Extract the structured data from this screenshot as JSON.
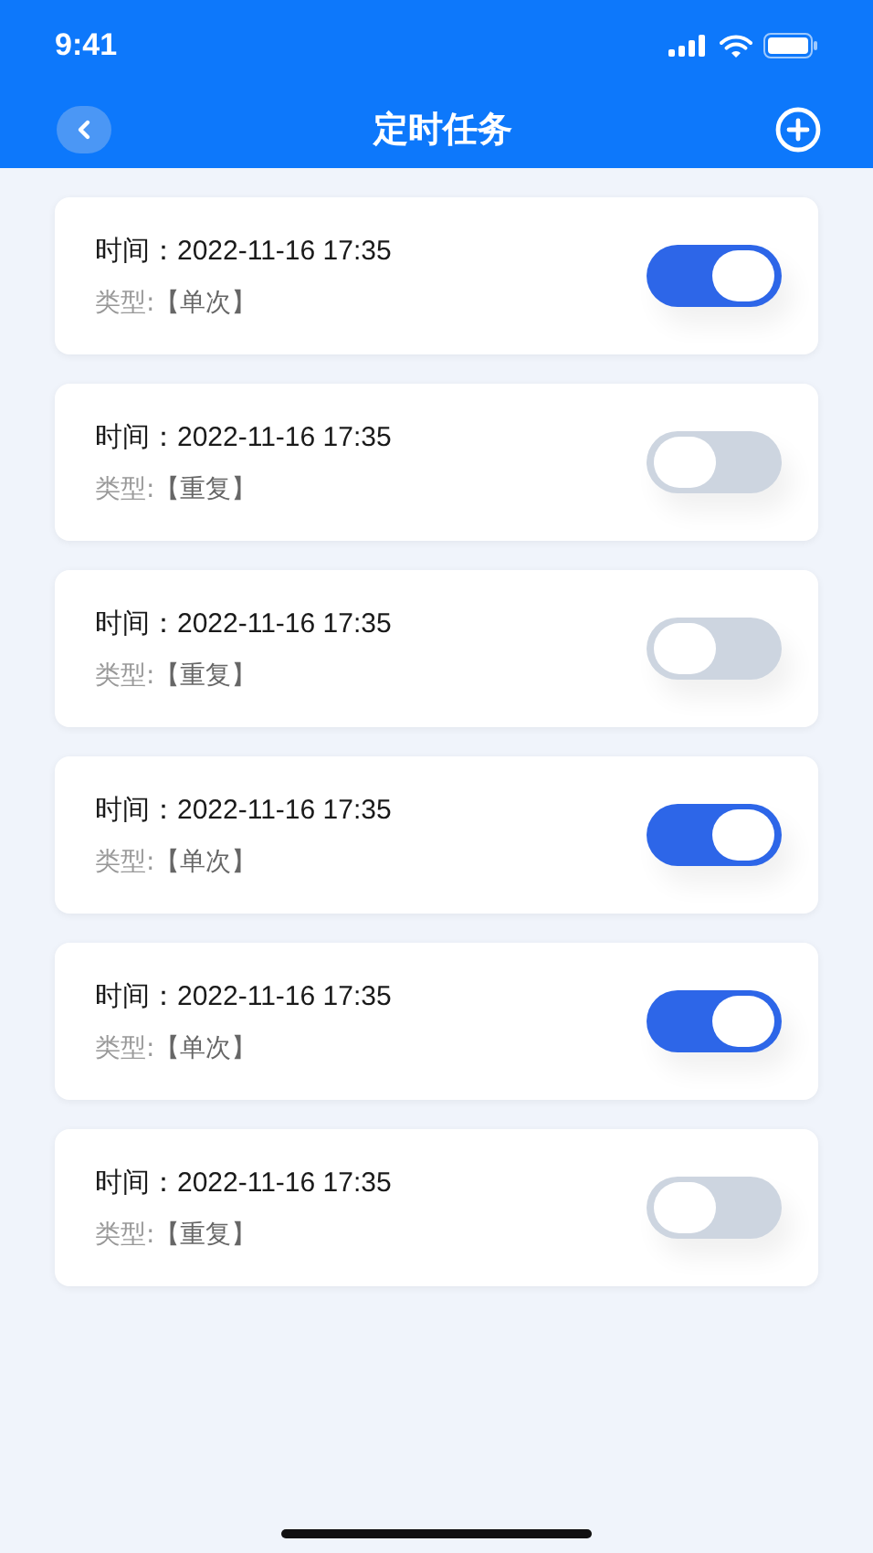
{
  "status_bar": {
    "time": "9:41"
  },
  "nav": {
    "title": "定时任务"
  },
  "tasks": [
    {
      "time": "时间：2022-11-16 17:35",
      "type_label": "类型:",
      "type": "【单次】",
      "on": true
    },
    {
      "time": "时间：2022-11-16 17:35",
      "type_label": "类型:",
      "type": "【重复】",
      "on": false
    },
    {
      "time": "时间：2022-11-16 17:35",
      "type_label": "类型:",
      "type": "【重复】",
      "on": false
    },
    {
      "time": "时间：2022-11-16 17:35",
      "type_label": "类型:",
      "type": "【单次】",
      "on": true
    },
    {
      "time": "时间：2022-11-16 17:35",
      "type_label": "类型:",
      "type": "【单次】",
      "on": true
    },
    {
      "time": "时间：2022-11-16 17:35",
      "type_label": "类型:",
      "type": "【重复】",
      "on": false
    }
  ]
}
